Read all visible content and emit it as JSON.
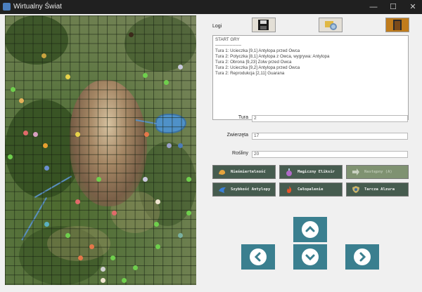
{
  "window": {
    "title": "Wirtualny Świat",
    "minimize": "—",
    "maximize": "☐",
    "close": "✕"
  },
  "toolbar": {
    "save_icon": "floppy-save-icon",
    "load_icon": "load-world-icon",
    "exit_icon": "exit-door-icon"
  },
  "logs": {
    "label": "Logi",
    "lines": [
      "START GRY",
      "------------------",
      "Tura 1: Ucieczka [9,1] Antylopa przed Owca",
      "Tura 2: Potyczka [8,1] Antylopa z Owca, wygrywa: Antylopa",
      "Tura 2: Obrona [9,23] Zolw przed Owca",
      "Tura 2: Ucieczka [9,2] Antylopa przed Owca",
      "Tura 2: Reprodukcja [2,11] Guarana"
    ]
  },
  "stats": {
    "turn_label": "Tura",
    "turn_value": "2",
    "animals_label": "Zwierzęta",
    "animals_value": "17",
    "plants_label": "Rośliny",
    "plants_value": "20"
  },
  "abilities": {
    "immortality": "Nieśmiertelność",
    "elixir": "Magiczny Eliksir",
    "next": "Następny (A)",
    "antelope_speed": "Szybkość Antylopy",
    "burning": "Całopalenie",
    "alzur_shield": "Tarcza Alzura"
  },
  "navigation": {
    "up": "arrow-up-icon",
    "left": "arrow-left-icon",
    "down": "arrow-down-icon",
    "right": "arrow-right-icon"
  },
  "colors": {
    "ability_bg": "#465c4f",
    "nav_bg": "#3a7f8f"
  }
}
